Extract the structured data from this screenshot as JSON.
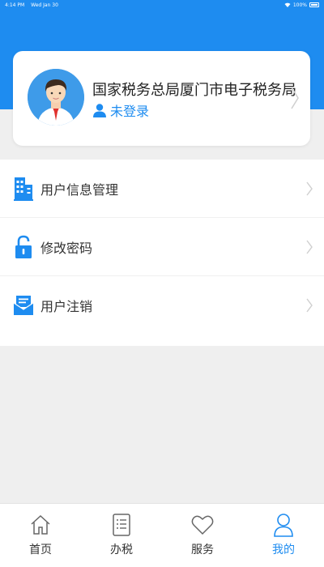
{
  "status_bar": {
    "time": "4:14 PM",
    "date": "Wed Jan 30",
    "battery": "100%"
  },
  "profile": {
    "org_name": "国家税务总局厦门市电子税务局",
    "login_status": "未登录"
  },
  "menu": {
    "items": [
      {
        "label": "用户信息管理",
        "icon": "building-icon"
      },
      {
        "label": "修改密码",
        "icon": "lock-icon"
      },
      {
        "label": "用户注销",
        "icon": "mail-icon"
      }
    ]
  },
  "tabbar": {
    "active_tab": "我的",
    "tabs": [
      {
        "label": "首页",
        "icon": "home-icon"
      },
      {
        "label": "办税",
        "icon": "document-icon"
      },
      {
        "label": "服务",
        "icon": "heart-icon"
      },
      {
        "label": "我的",
        "icon": "user-icon"
      }
    ]
  },
  "colors": {
    "accent": "#1e8cf0",
    "background": "#efefef"
  }
}
